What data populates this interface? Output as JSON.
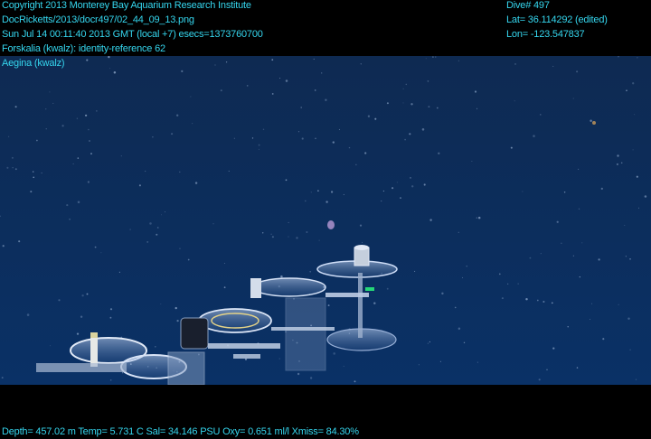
{
  "header": {
    "copyright": "Copyright 2013 Monterey Bay Aquarium Research Institute",
    "image_path": "DocRicketts/2013/docr497/02_44_09_13.png",
    "timestamp": "Sun Jul 14 00:11:40 2013 GMT (local +7)  esecs=1373760700",
    "annotation_1": "Forskalia (kwalz): identity-reference 62",
    "annotation_2": "Aegina (kwalz)",
    "dive": "Dive# 497",
    "lat": "Lat= 36.114292 (edited)",
    "lon": "Lon= -123.547837"
  },
  "footer": {
    "telemetry": "Depth= 457.02 m  Temp= 5.731 C  Sal= 34.146 PSU  Oxy= 0.651 ml/l  Xmiss= 84.30%"
  },
  "colors": {
    "overlay_text": "#35d6ee",
    "water_top": "#0e2a52",
    "water_bottom": "#0a3166"
  }
}
